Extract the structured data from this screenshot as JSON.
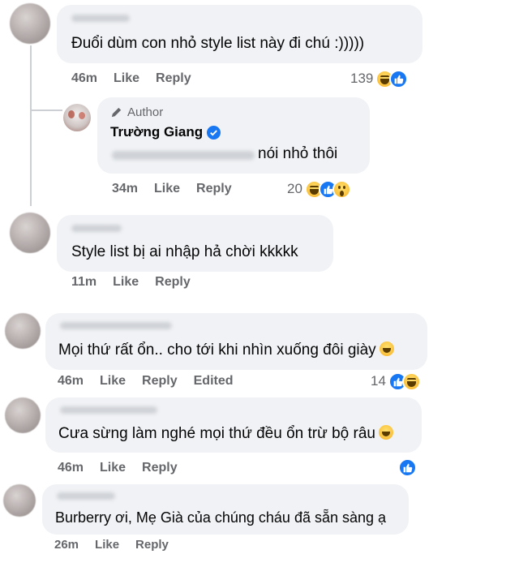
{
  "comments": [
    {
      "text": "Đuổi dùm con nhỏ style list này đi chú :)))))",
      "actions": {
        "time": "46m",
        "like": "Like",
        "reply": "Reply"
      },
      "reaction_count": "139",
      "reaction_icons": [
        "haha-icon",
        "like-icon"
      ]
    },
    {
      "author_tag": "Author",
      "author_name": "Trường Giang",
      "verified_icon": "verified-badge-icon",
      "text": "nói nhỏ thôi",
      "actions": {
        "time": "34m",
        "like": "Like",
        "reply": "Reply"
      },
      "reaction_count": "20",
      "reaction_icons": [
        "haha-icon",
        "like-icon",
        "wow-icon"
      ]
    },
    {
      "text": "Style list bị ai nhập hả chời kkkkk",
      "actions": {
        "time": "11m",
        "like": "Like",
        "reply": "Reply"
      }
    },
    {
      "text": "Mọi thứ rất ổn.. cho tới khi nhìn xuống đôi giày",
      "text_emoji": "rolling-laughing-emoji",
      "actions": {
        "time": "46m",
        "like": "Like",
        "reply": "Reply",
        "edited": "Edited"
      },
      "reaction_count": "14",
      "reaction_icons": [
        "like-icon",
        "haha-icon"
      ]
    },
    {
      "text": "Cưa sừng làm nghé mọi thứ đều ổn trừ bộ râu",
      "text_emoji": "grinning-squinting-emoji",
      "actions": {
        "time": "46m",
        "like": "Like",
        "reply": "Reply"
      },
      "reaction_icons": [
        "like-icon"
      ]
    },
    {
      "text": "Burberry ơi, Mẹ Già của chúng cháu đã sẵn sàng ạ",
      "actions": {
        "time": "26m",
        "like": "Like",
        "reply": "Reply"
      }
    }
  ],
  "colors": {
    "bubble": "#f0f2f5",
    "meta_text": "#65676b",
    "like_blue": "#1877f2",
    "body_text": "#050505"
  }
}
